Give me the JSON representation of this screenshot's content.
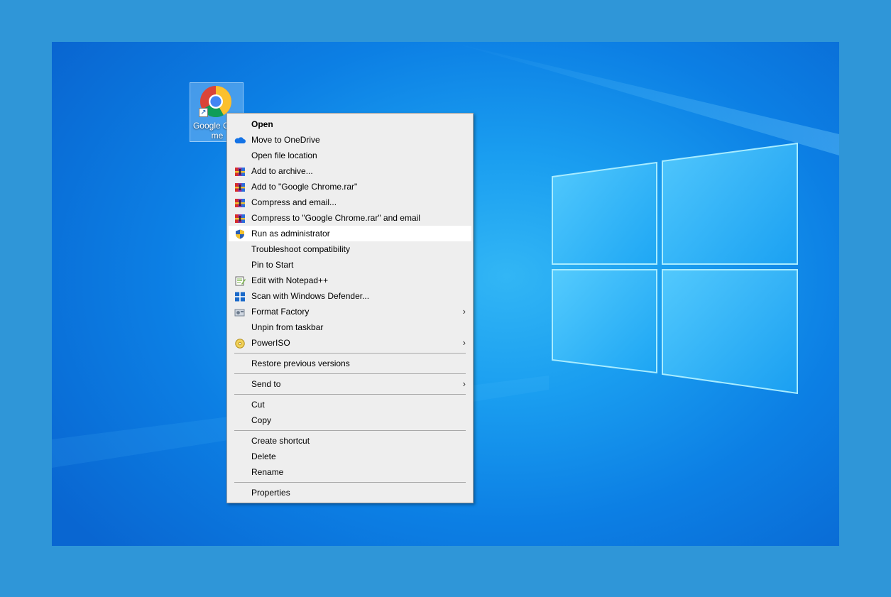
{
  "desktop": {
    "shortcut": {
      "label": "Google Chrome",
      "icon": "chrome-icon",
      "overlay": "shortcut-arrow-icon"
    }
  },
  "context_menu": {
    "groups": [
      [
        {
          "label": "Open",
          "bold": true,
          "icon": ""
        },
        {
          "label": "Move to OneDrive",
          "icon": "onedrive-icon"
        },
        {
          "label": "Open file location",
          "icon": ""
        },
        {
          "label": "Add to archive...",
          "icon": "winrar-icon"
        },
        {
          "label": "Add to \"Google Chrome.rar\"",
          "icon": "winrar-icon"
        },
        {
          "label": "Compress and email...",
          "icon": "winrar-icon"
        },
        {
          "label": "Compress to \"Google Chrome.rar\" and email",
          "icon": "winrar-icon"
        },
        {
          "label": "Run as administrator",
          "icon": "uac-shield-icon",
          "hovered": true
        },
        {
          "label": "Troubleshoot compatibility",
          "icon": ""
        },
        {
          "label": "Pin to Start",
          "icon": ""
        },
        {
          "label": "Edit with Notepad++",
          "icon": "notepadpp-icon"
        },
        {
          "label": "Scan with Windows Defender...",
          "icon": "defender-icon"
        },
        {
          "label": "Format Factory",
          "icon": "format-factory-icon",
          "submenu": true
        },
        {
          "label": "Unpin from taskbar",
          "icon": ""
        },
        {
          "label": "PowerISO",
          "icon": "poweriso-icon",
          "submenu": true
        }
      ],
      [
        {
          "label": "Restore previous versions",
          "icon": ""
        }
      ],
      [
        {
          "label": "Send to",
          "icon": "",
          "submenu": true
        }
      ],
      [
        {
          "label": "Cut",
          "icon": ""
        },
        {
          "label": "Copy",
          "icon": ""
        }
      ],
      [
        {
          "label": "Create shortcut",
          "icon": ""
        },
        {
          "label": "Delete",
          "icon": ""
        },
        {
          "label": "Rename",
          "icon": ""
        }
      ],
      [
        {
          "label": "Properties",
          "icon": ""
        }
      ]
    ]
  },
  "colors": {
    "frame": "#2f96d8",
    "menu_bg": "#eeeeee",
    "menu_hover": "#ffffff",
    "separator": "#a8a8a8"
  }
}
